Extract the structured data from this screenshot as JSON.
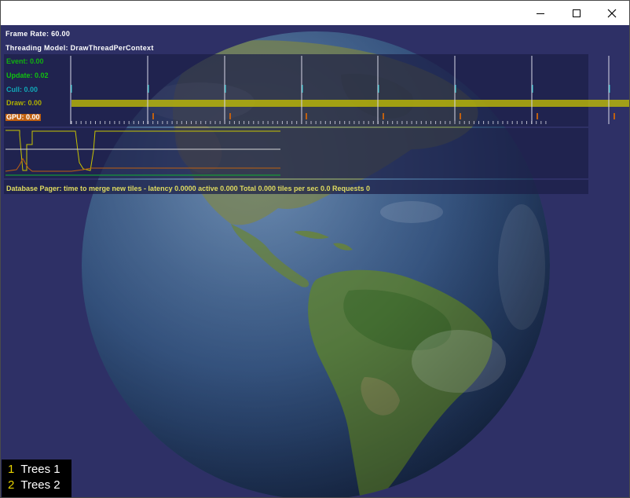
{
  "window": {
    "controls": {
      "minimize_icon": "minimize-icon",
      "maximize_icon": "maximize-icon",
      "close_icon": "close-icon"
    }
  },
  "stats": {
    "frame_rate": "Frame Rate: 60.00",
    "threading_model": "Threading Model: DrawThreadPerContext",
    "labels": {
      "event": "Event: 0.00",
      "update": "Update: 0.02",
      "cull": "Cull: 0.00",
      "draw": "Draw: 0.00",
      "gpu": "GPU: 0.00"
    },
    "info_line": "Database Pager: time to merge new tiles - latency 0.0000  active 0.000  Total 0.000 tiles per sec 0.0  Requests 0",
    "colors": {
      "event": "#10b010",
      "update": "#10c010",
      "cull": "#10a8b8",
      "draw": "#b0b000",
      "gpu": "#c06010",
      "draw_bar": "#c8c400"
    }
  },
  "legend": {
    "items": [
      {
        "key": "1",
        "name": "Trees 1"
      },
      {
        "key": "2",
        "name": "Trees 2"
      }
    ]
  }
}
